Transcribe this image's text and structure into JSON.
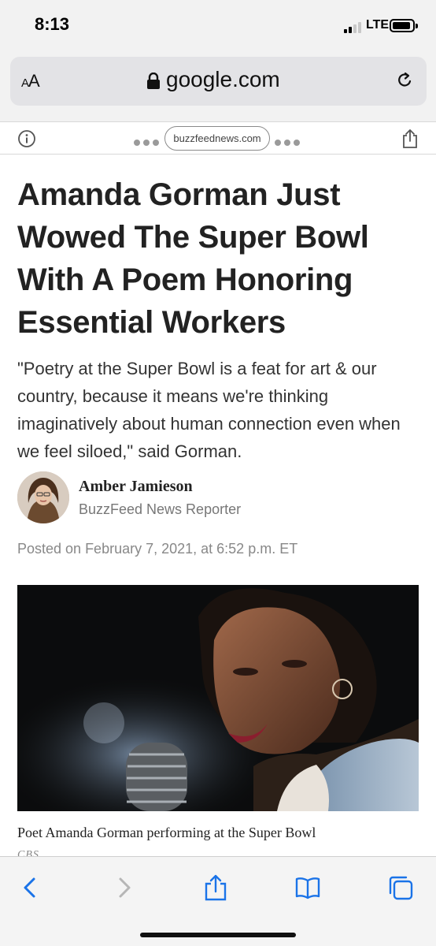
{
  "status_bar": {
    "time": "8:13",
    "network": "LTE"
  },
  "browser": {
    "text_size_label": "AA",
    "url": "google.com",
    "site_domain": "buzzfeednews.com"
  },
  "article": {
    "headline": "Amanda Gorman Just Wowed The Super Bowl With A Poem Honoring Essential Workers",
    "dek": "\"Poetry at the Super Bowl is a feat for art & our country, because it means we're thinking imaginatively about human connection even when we feel siloed,\" said Gorman.",
    "author": {
      "name": "Amber Jamieson",
      "role": "BuzzFeed News Reporter"
    },
    "posted": "Posted on February 7, 2021, at 6:52 p.m. ET",
    "photo": {
      "caption": "Poet Amanda Gorman performing at the Super Bowl",
      "credit": "CBS"
    }
  },
  "colors": {
    "chrome_background": "#f2f2f2",
    "address_field": "#e3e3e6",
    "toolbar_icons": "#1a73e8",
    "toolbar_disabled": "#b6b6b6"
  },
  "icons": {
    "lock": "lock-icon",
    "reload": "reload-icon",
    "info": "info-icon",
    "share": "share-icon",
    "back": "chevron-left-icon",
    "forward": "chevron-right-icon",
    "bookmarks": "book-icon",
    "tabs": "tabs-icon"
  }
}
